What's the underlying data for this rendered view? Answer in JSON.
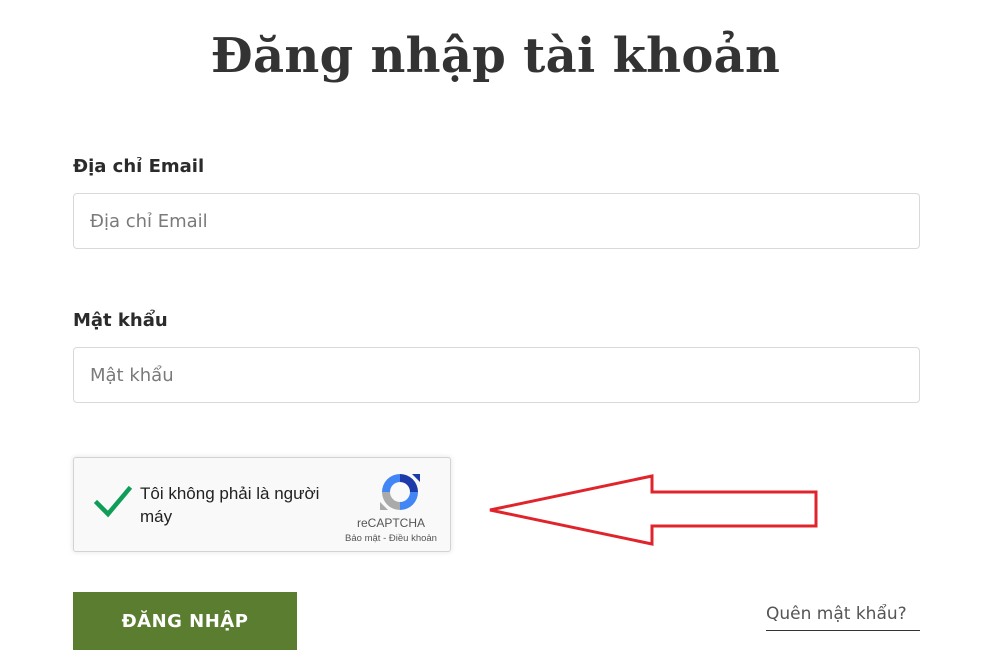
{
  "page": {
    "title": "Đăng nhập tài khoản"
  },
  "form": {
    "email": {
      "label": "Địa chỉ Email",
      "placeholder": "Địa chỉ Email",
      "value": ""
    },
    "password": {
      "label": "Mật khẩu",
      "placeholder": "Mật khẩu",
      "value": ""
    },
    "submit_label": "ĐĂNG NHẬP",
    "forgot_label": "Quên mật khẩu?"
  },
  "captcha": {
    "checked": true,
    "text": "Tôi không phải là người máy",
    "brand": "reCAPTCHA",
    "privacy_label": "Bảo mật",
    "separator": " - ",
    "terms_label": "Điều khoản"
  },
  "colors": {
    "primary_button": "#5a7d2f",
    "check": "#0f9d58",
    "arrow": "#e0242c",
    "title": "#333333"
  },
  "icons": {
    "captcha_check": "checkmark-icon",
    "captcha_logo": "recaptcha-logo-icon",
    "annotation": "arrow-left-icon"
  }
}
